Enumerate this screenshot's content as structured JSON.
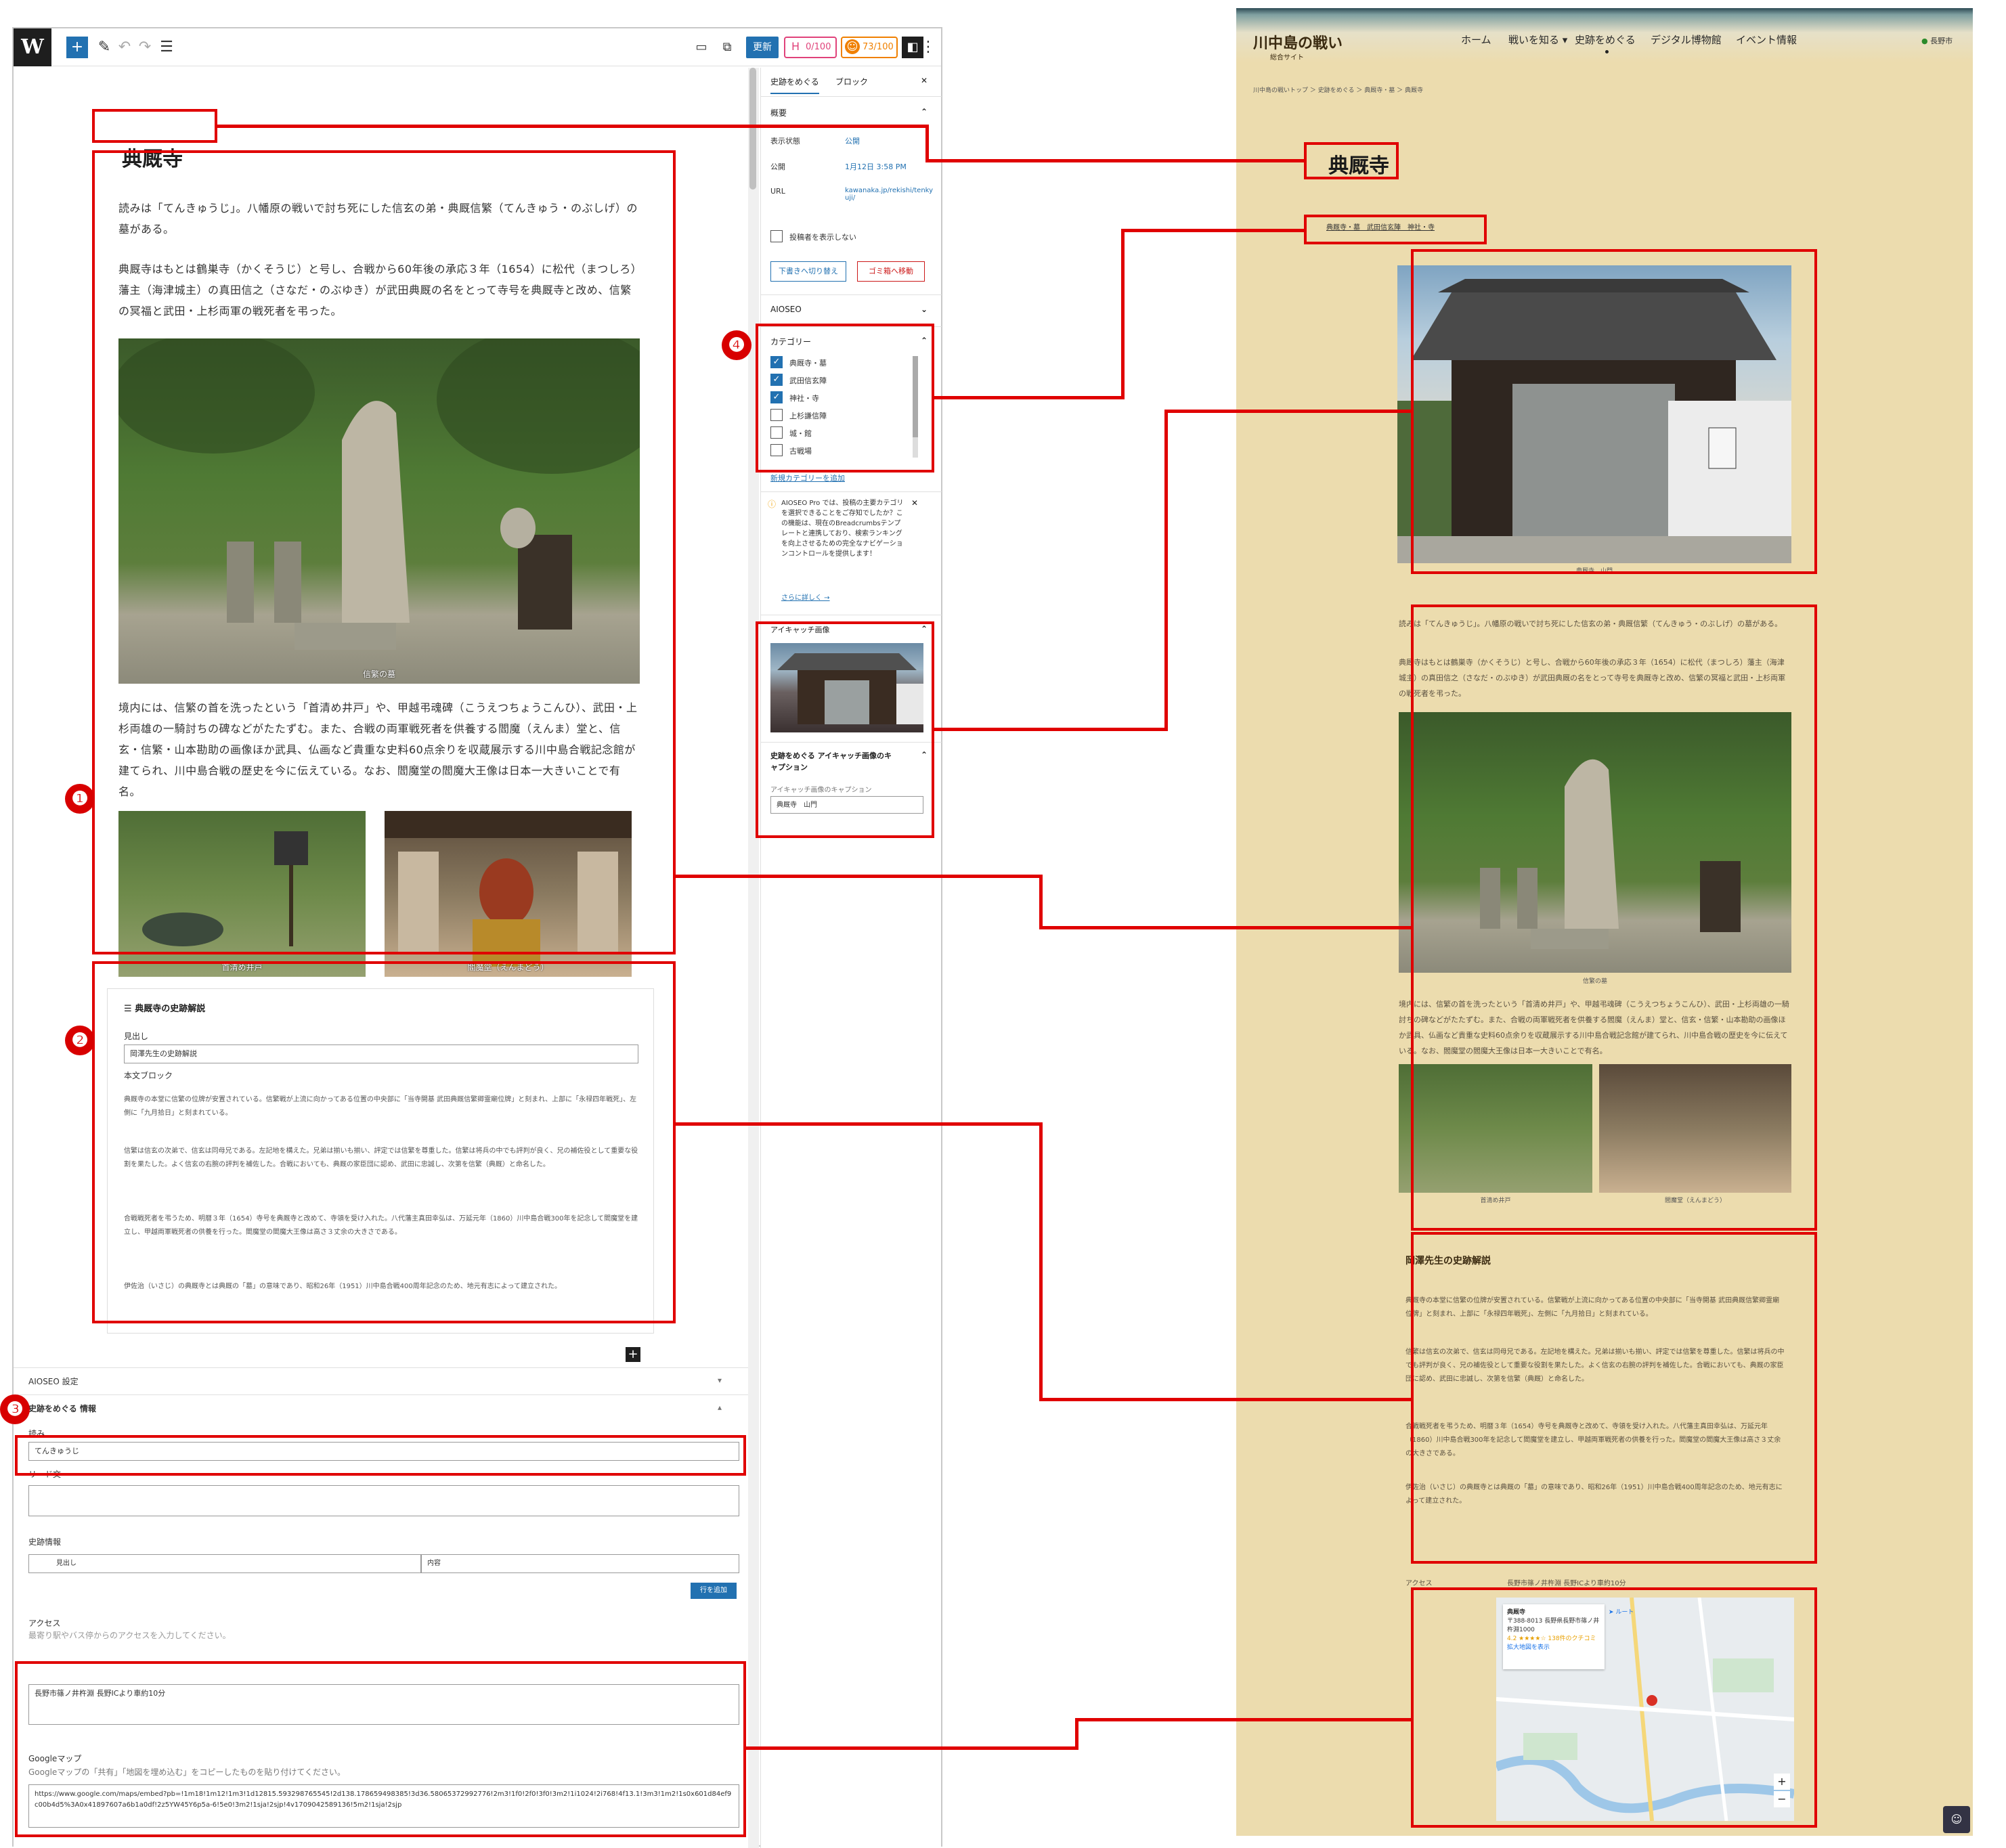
{
  "editor": {
    "toolbar": {
      "wp_logo": "W",
      "add_button": "+",
      "update_label": "更新",
      "seo_score": "0/100",
      "aioseo_score": "73/100",
      "icons": [
        "wordpress-icon",
        "plus-icon",
        "pencil-icon",
        "undo-icon",
        "redo-icon",
        "list-view-icon",
        "desktop-icon",
        "external-link-icon",
        "sidebar-toggle-icon",
        "more-vertical-icon"
      ]
    },
    "post": {
      "title": "典厩寺",
      "para1": "読みは「てんきゅうじ」。八幡原の戦いで討ち死にした信玄の弟・典厩信繁（てんきゅう・のぶしげ）の墓がある。",
      "para2": "典厩寺はもとは鶴巣寺（かくそうじ）と号し、合戦から60年後の承応３年（1654）に松代（まつしろ）藩主（海津城主）の真田信之（さなだ・のぶゆき）が武田典厩の名をとって寺号を典厩寺と改め、信繁の冥福と武田・上杉両軍の戦死者を弔った。",
      "para3": "境内には、信繁の首を洗ったという「首清め井戸」や、甲越弔魂碑（こうえつちょうこんひ）、武田・上杉両雄の一騎討ちの碑などがたたずむ。また、合戦の両軍戦死者を供養する閻魔（えんま）堂と、信玄・信繁・山本勘助の画像ほか武具、仏画など貴重な史料60点余りを収蔵展示する川中島合戦記念館が建てられ、川中島合戦の歴史を今に伝えている。なお、閻魔堂の閻魔大王像は日本一大きいことで有名。",
      "photo_caption_1": "信繁の墓",
      "photo_caption_2": "首清め井戸",
      "photo_caption_3": "閻魔堂（えんまどう）"
    },
    "commentary_block": {
      "heading": "典厩寺の史跡解説",
      "label_heading": "見出し",
      "heading_value": "岡澤先生の史跡解説",
      "label_body": "本文ブロック",
      "body1": "典厩寺の本堂に信繁の位牌が安置されている。信繁戦が上流に向かってある位置の中央部に「当寺開基 武田典厩信繁卿霊廟位牌」と刻まれ、上部に「永禄四年戦死」、左側に「九月拾日」と刻まれている。",
      "body2": "信繁は信玄の次弟で、信玄は同母兄である。左記地を構えた。兄弟は揃いも揃い、評定では信繁を尊重した。信繁は将兵の中でも評判が良く、兄の補佐役として重要な役割を果たした。よく信玄の右腕の評判を補佐した。合戦においても、典厩の家臣団に認め、武田に忠誠し、次第を信繁（典厩）と命名した。",
      "body3": "合戦戦死者を弔うため、明暦３年（1654）寺号を典厩寺と改めて、寺領を受け入れた。八代藩主真田幸弘は、万延元年（1860）川中島合戦300年を記念して閻魔堂を建立し、甲越両軍戦死者の供養を行った。閻魔堂の閻魔大王像は高さ３丈余の大きさである。",
      "body4": "伊佐治（いさじ）の典厩寺とは典厩の「墓」の意味であり、昭和26年（1951）川中島合戦400周年記念のため、地元有志によって建立された。"
    },
    "meta": {
      "aioseo_settings": "AIOSEO 設定",
      "meta_box_title": "史跡をめぐる 情報",
      "label_yomi": "読み",
      "yomi_value": "てんきゅうじ",
      "label_lead": "リード文",
      "label_info": "史跡情報",
      "info_col1": "見出し",
      "info_col2": "内容",
      "add_row": "行を追加",
      "label_access": "アクセス",
      "access_desc": "最寄り駅やバス停からのアクセスを入力してください。",
      "access_value": "長野市篠ノ井杵淵 長野ICより車約10分",
      "label_gmap": "Googleマップ",
      "gmap_desc": "Googleマップの「共有」「地図を埋め込む」をコピーしたものを貼り付けてください。",
      "gmap_value": "https://www.google.com/maps/embed?pb=!1m18!1m12!1m3!1d12815.593298765545!2d138.178659498385!3d36.58065372992776!2m3!1f0!2f0!3f0!3m2!1i1024!2i768!4f13.1!3m3!1m2!1s0x601d84ef9c00b4d5%3A0x41897607a6b1a0df!2z5YW45Y6p5a-6!5e0!3m2!1sja!2sjp!4v1709042589136!5m2!1sja!2sjp"
    },
    "sidebar": {
      "tab1": "史跡をめぐる",
      "tab2": "ブロック",
      "summary_head": "概要",
      "status_label": "表示状態",
      "status_value": "公開",
      "publish_label": "公開",
      "publish_value": "1月12日 3:58 PM",
      "url_label": "URL",
      "url_value": "kawanaka.jp/rekishi/tenkyuji/",
      "hide_title_label": "投稿者を表示しない",
      "draft_button": "下書きへ切り替え",
      "trash_button": "ゴミ箱へ移動",
      "aioseo_head": "AIOSEO",
      "category_head": "カテゴリー",
      "categories": [
        {
          "label": "典厩寺・墓",
          "checked": true
        },
        {
          "label": "武田信玄陣",
          "checked": true
        },
        {
          "label": "神社・寺",
          "checked": true
        },
        {
          "label": "上杉謙信陣",
          "checked": false
        },
        {
          "label": "城・館",
          "checked": false
        },
        {
          "label": "古戦場",
          "checked": false
        }
      ],
      "add_category": "新規カテゴリーを追加",
      "notice": "AIOSEO Pro では、投稿の主要カテゴリを選択できることをご存知でしたか？この機能は、現在のBreadcrumbsテンプレートと連携しており、検索ランキングを向上させるための完全なナビゲーションコントロールを提供します！",
      "notice_link": "さらに詳しく →",
      "eyecatch_head": "アイキャッチ画像",
      "caption_head": "史跡をめぐる アイキャッチ画像のキャプション",
      "caption_label": "アイキャッチ画像のキャプション",
      "caption_value": "典厩寺　山門"
    }
  },
  "site": {
    "logo": "川中島の戦い",
    "logo_sub": "総合サイト",
    "nav": [
      "ホーム",
      "戦いを知る ▾",
      "史跡をめぐる",
      "デジタル博物館",
      "イベント情報"
    ],
    "login": "長野市",
    "breadcrumb": "川中島の戦いトップ ＞ 史跡をめぐる ＞ 典厩寺・墓 ＞ 典厩寺",
    "title": "典厩寺",
    "categories": "典厩寺・墓　武田信玄陣　神社・寺",
    "eyecatch_caption": "典厩寺　山門",
    "section_heading": "岡澤先生の史跡解説",
    "access_label": "アクセス",
    "access_value": "長野市篠ノ井杵淵 長野ICより車約10分",
    "map": {
      "place": "典厩寺",
      "address": "〒388-8013 長野県長野市篠ノ井杵淵1000",
      "rating": "4.2 ★★★★☆ 138件のクチコミ",
      "enlarge": "拡大地図を表示",
      "route": "ルート"
    }
  },
  "annotations": [
    "❶",
    "❷",
    "❸",
    "❹"
  ],
  "colors": {
    "annotation": "#e00000",
    "wp_blue": "#2271b1",
    "site_bg": "#ecdcae"
  }
}
